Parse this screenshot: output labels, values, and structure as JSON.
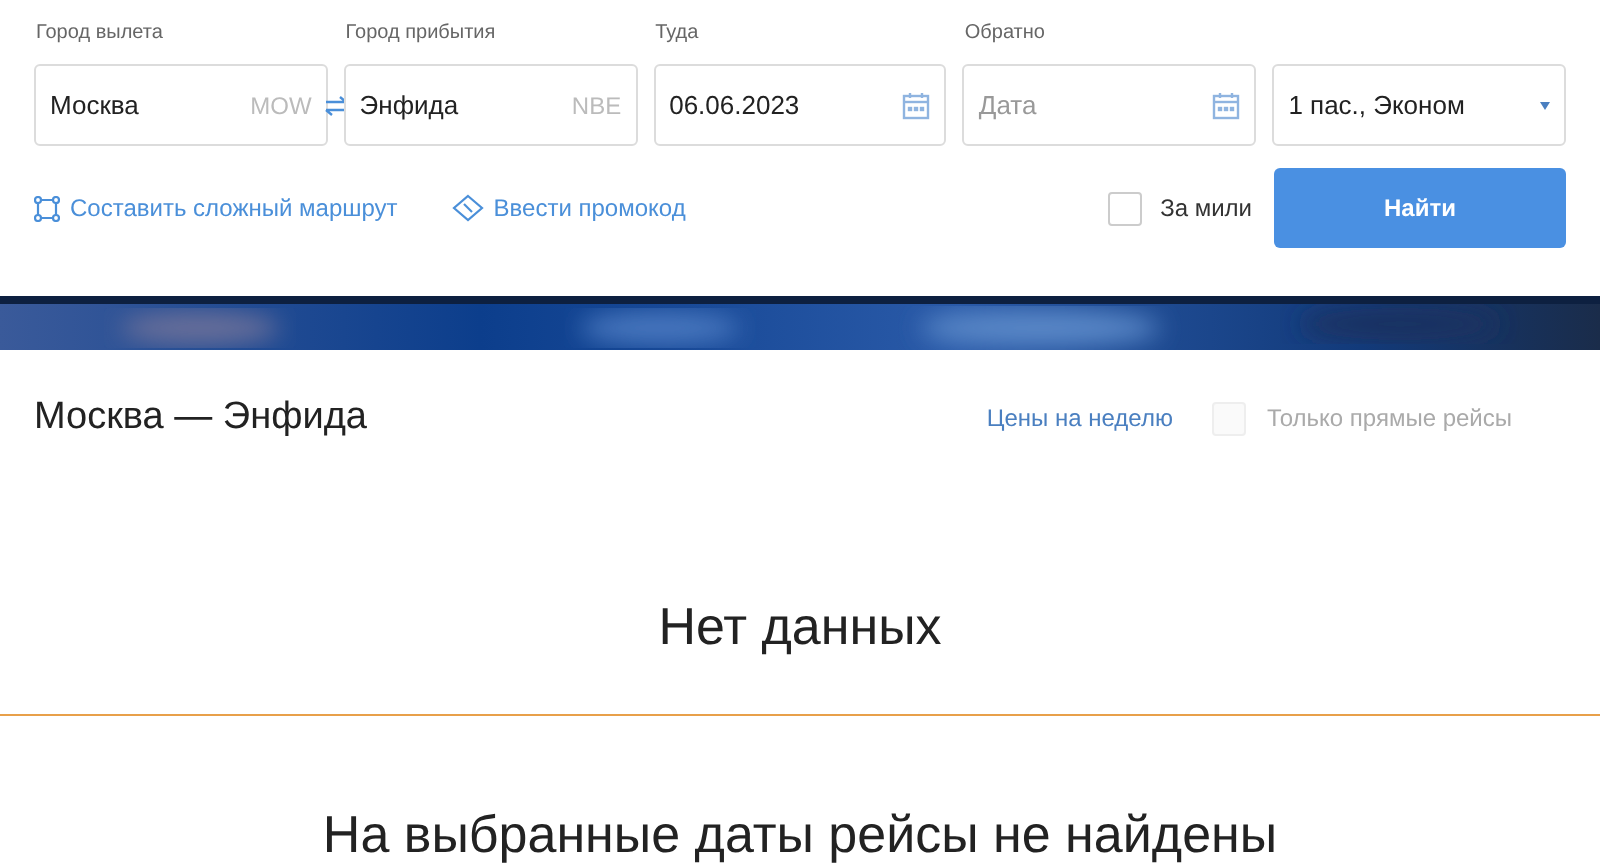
{
  "search_form": {
    "fields": [
      {
        "label": "Город вылета",
        "value": "Москва",
        "code": "MOW",
        "kind": "city"
      },
      {
        "label": "Город прибытия",
        "value": "Энфида",
        "code": "NBE",
        "kind": "city"
      },
      {
        "label": "Туда",
        "value": "06.06.2023",
        "kind": "date"
      },
      {
        "label": "Обратно",
        "placeholder": "Дата",
        "kind": "date"
      },
      {
        "value": "1 пас., Эконом",
        "kind": "select"
      }
    ],
    "complex_route_link": "Составить сложный маршрут",
    "promo_link": "Ввести промокод",
    "miles_checkbox": {
      "label": "За мили",
      "checked": false
    },
    "search_button": "Найти"
  },
  "results": {
    "title": "Москва — Энфида",
    "week_prices_link": "Цены на неделю",
    "direct_only": {
      "label": "Только прямые рейсы",
      "checked": false,
      "disabled": true
    },
    "empty_title": "Нет данных",
    "empty_message": "На выбранные даты рейсы не найдены"
  }
}
